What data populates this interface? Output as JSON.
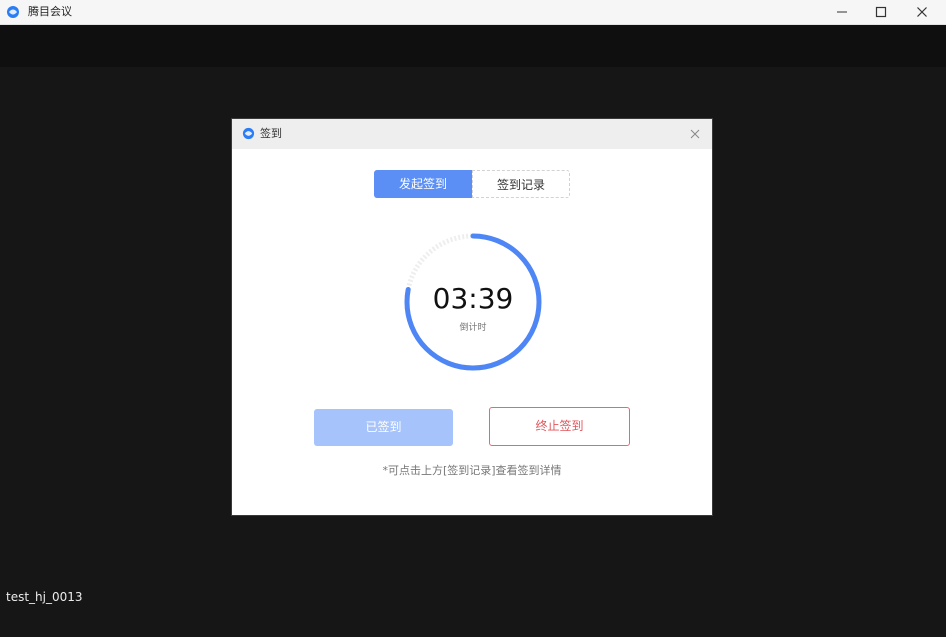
{
  "window": {
    "title": "腾目会议",
    "controls": [
      "minimize-icon",
      "maximize-icon",
      "close-icon"
    ]
  },
  "stage": {
    "participant_name": "test_hj_0013"
  },
  "dialog": {
    "title": "签到",
    "tabs": [
      {
        "label": "发起签到",
        "active": true
      },
      {
        "label": "签到记录",
        "active": false
      }
    ],
    "timer": {
      "value": "03:39",
      "label": "倒计时",
      "progress": 0.78
    },
    "buttons": {
      "signed": "已签到",
      "stop": "终止签到"
    },
    "hint": "*可点击上方[签到记录]查看签到详情"
  },
  "colors": {
    "accent": "#5b8ff6",
    "accent_disabled": "#a7c3fb",
    "danger": "#e0555a",
    "background": "#161616"
  }
}
